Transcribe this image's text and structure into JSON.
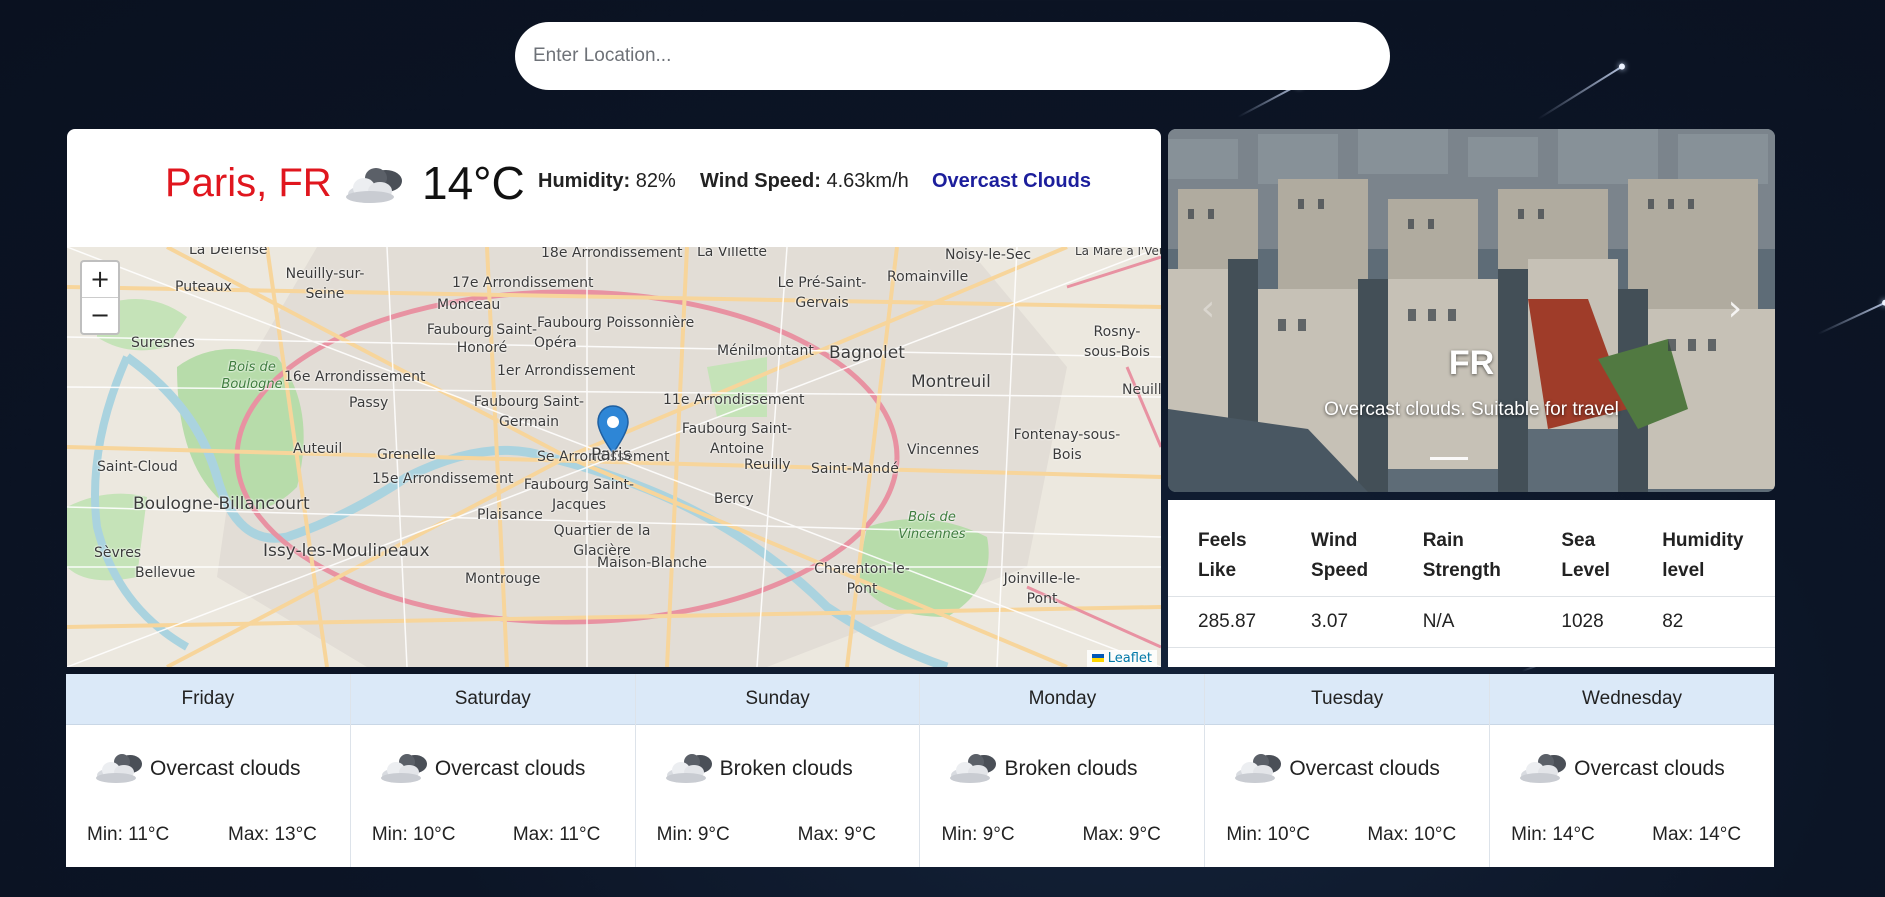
{
  "search": {
    "placeholder": "Enter Location..."
  },
  "current": {
    "city": "Paris, FR",
    "temperature": "14°C",
    "humidity_label": "Humidity:",
    "humidity_value": "82%",
    "wind_label": "Wind Speed:",
    "wind_value": "4.63km/h",
    "description": "Overcast Clouds",
    "icon": "overcast-clouds-icon"
  },
  "map": {
    "zoom_in": "+",
    "zoom_out": "−",
    "attribution": "Leaflet",
    "marker_label": "Paris",
    "labels": [
      "La Défense",
      "18e Arrondissement",
      "La Villette",
      "Noisy-le-Sec",
      "La Mare à l'Veuve",
      "Puteaux",
      "Neuilly-sur-Seine",
      "17e Arrondissement",
      "Le Pré-Saint-Gervais",
      "Romainville",
      "Monceau",
      "Faubourg Poissonnière",
      "Suresnes",
      "Faubourg Saint-Honoré",
      "Opéra",
      "Bagnolet",
      "Rosny-sous-Bois",
      "Ménilmontant",
      "Bois de Boulogne",
      "16e Arrondissement",
      "1er Arrondissement",
      "Montreuil",
      "Passy",
      "Faubourg Saint-Germain",
      "11e Arrondissement",
      "Neuilly",
      "Faubourg Saint-Antoine",
      "Fontenay-sous-Bois",
      "Auteuil",
      "Grenelle",
      "Se Arrondissement",
      "Reuilly",
      "Vincennes",
      "Saint-Cloud",
      "15e Arrondissement",
      "Saint-Mandé",
      "Faubourg Saint-Jacques",
      "Bercy",
      "Boulogne-Billancourt",
      "Plaisance",
      "Bois de Vincennes",
      "Quartier de la Glacière",
      "Sèvres",
      "Issy-les-Moulineaux",
      "Maison-Blanche",
      "Charenton-le-Pont",
      "Joinville-le-Pont",
      "Bellevue",
      "Montrouge"
    ]
  },
  "carousel": {
    "title": "FR",
    "subtitle": "Overcast clouds. Suitable for travel",
    "prev": "‹",
    "next": "›"
  },
  "details": {
    "headers": [
      [
        "Feels",
        "Like"
      ],
      [
        "Wind",
        "Speed"
      ],
      [
        "Rain",
        "Strength"
      ],
      [
        "Sea",
        "Level"
      ],
      [
        "Humidity",
        "level"
      ]
    ],
    "values": [
      "285.87",
      "3.07",
      "N/A",
      "1028",
      "82"
    ]
  },
  "forecast": [
    {
      "day": "Friday",
      "condition": "Overcast clouds",
      "min": "Min: 11°C",
      "max": "Max: 13°C"
    },
    {
      "day": "Saturday",
      "condition": "Overcast clouds",
      "min": "Min: 10°C",
      "max": "Max: 11°C"
    },
    {
      "day": "Sunday",
      "condition": "Broken clouds",
      "min": "Min: 9°C",
      "max": "Max: 9°C"
    },
    {
      "day": "Monday",
      "condition": "Broken clouds",
      "min": "Min: 9°C",
      "max": "Max: 9°C"
    },
    {
      "day": "Tuesday",
      "condition": "Overcast clouds",
      "min": "Min: 10°C",
      "max": "Max: 10°C"
    },
    {
      "day": "Wednesday",
      "condition": "Overcast clouds",
      "min": "Min: 14°C",
      "max": "Max: 14°C"
    }
  ]
}
